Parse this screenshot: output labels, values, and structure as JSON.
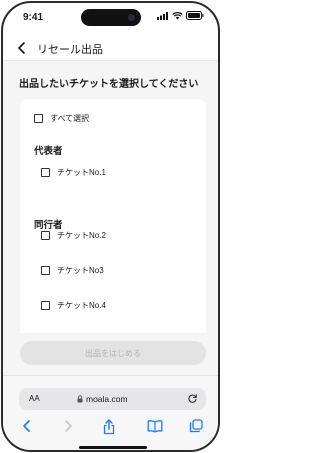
{
  "status": {
    "time": "9:41"
  },
  "nav": {
    "title": "リセール出品"
  },
  "main": {
    "heading": "出品したいチケットを選択してください",
    "select_all": "すべて選択",
    "sections": [
      {
        "label": "代表者",
        "tickets": [
          "チケットNo.1"
        ]
      },
      {
        "label": "同行者",
        "tickets": [
          "チケットNo.2",
          "チケットNo3",
          "チケットNo.4"
        ]
      }
    ]
  },
  "cta": {
    "label": "出品をはじめる"
  },
  "browser": {
    "aa": "AA",
    "url": "moala.com"
  },
  "colors": {
    "accent": "#1a7cf5",
    "disabled_bg": "#e3e3e3",
    "disabled_text": "#b2b2b2"
  }
}
